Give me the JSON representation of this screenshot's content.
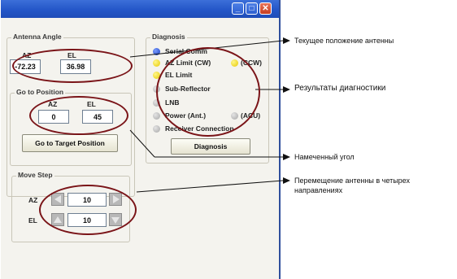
{
  "window": {
    "controls": {
      "minimize": "_",
      "maximize": "□",
      "close": "✕"
    }
  },
  "antenna_angle": {
    "title": "Antenna Angle",
    "az_label": "AZ",
    "el_label": "EL",
    "az_value": "-72.23",
    "el_value": "36.98"
  },
  "go_to_position": {
    "title": "Go to Position",
    "az_label": "AZ",
    "el_label": "EL",
    "az_value": "0",
    "el_value": "45",
    "button_label": "Go to Target Position"
  },
  "move_step": {
    "title": "Move Step",
    "az_label": "AZ",
    "el_label": "EL",
    "az_value": "10",
    "el_value": "10"
  },
  "diagnosis": {
    "title": "Diagnosis",
    "items": [
      {
        "label": "Serial Comm",
        "status_color": "#1a3fbf"
      },
      {
        "label": "AZ Limit (CW)",
        "status_color": "#e6c800"
      },
      {
        "label": "(CCW)",
        "status_color": "#e6c800"
      },
      {
        "label": "EL Limit",
        "status_color": "#e6c800"
      },
      {
        "label": "Sub-Reflector",
        "status_color": "#a6a6a6"
      },
      {
        "label": "LNB",
        "status_color": "#a6a6a6"
      },
      {
        "label": "Power (Ant.)",
        "status_color": "#a6a6a6"
      },
      {
        "label": "(ACU)",
        "status_color": "#a6a6a6"
      },
      {
        "label": "Receiver Connection",
        "status_color": "#a6a6a6"
      }
    ],
    "button_label": "Diagnosis"
  },
  "annotations": {
    "current_position": "Текущее положение антенны",
    "diagnosis_results": "Результаты диагностики",
    "target_angle": "Намеченный угол",
    "move_four_directions": "Перемещение антенны в четырех направлениях"
  },
  "colors": {
    "titlebar": "#2456c8",
    "annotation_line": "#7a1418"
  }
}
